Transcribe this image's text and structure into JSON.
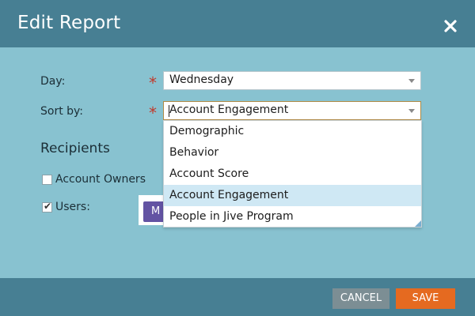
{
  "dialog": {
    "title": "Edit Report",
    "close_icon": "close-icon"
  },
  "form": {
    "day": {
      "label": "Day:",
      "value": "Wednesday",
      "required_marker": "*"
    },
    "sort_by": {
      "label": "Sort by:",
      "value": "Account Engagement",
      "required_marker": "*"
    }
  },
  "sort_dropdown": {
    "options": [
      "Demographic",
      "Behavior",
      "Account Score",
      "Account Engagement",
      "People in Jive Program"
    ],
    "selected": "Account Engagement"
  },
  "recipients": {
    "title": "Recipients",
    "account_owners": {
      "label": "Account Owners",
      "checked": false
    },
    "users": {
      "label": "Users:",
      "checked": true
    },
    "users_button_label": "M"
  },
  "footer": {
    "cancel_label": "CANCEL",
    "save_label": "SAVE"
  },
  "colors": {
    "header": "#477f93",
    "body": "#88c2d0",
    "save": "#e56a20",
    "cancel": "#7c8e94",
    "selected_option": "#cfe8f4",
    "required": "#c0392b"
  }
}
